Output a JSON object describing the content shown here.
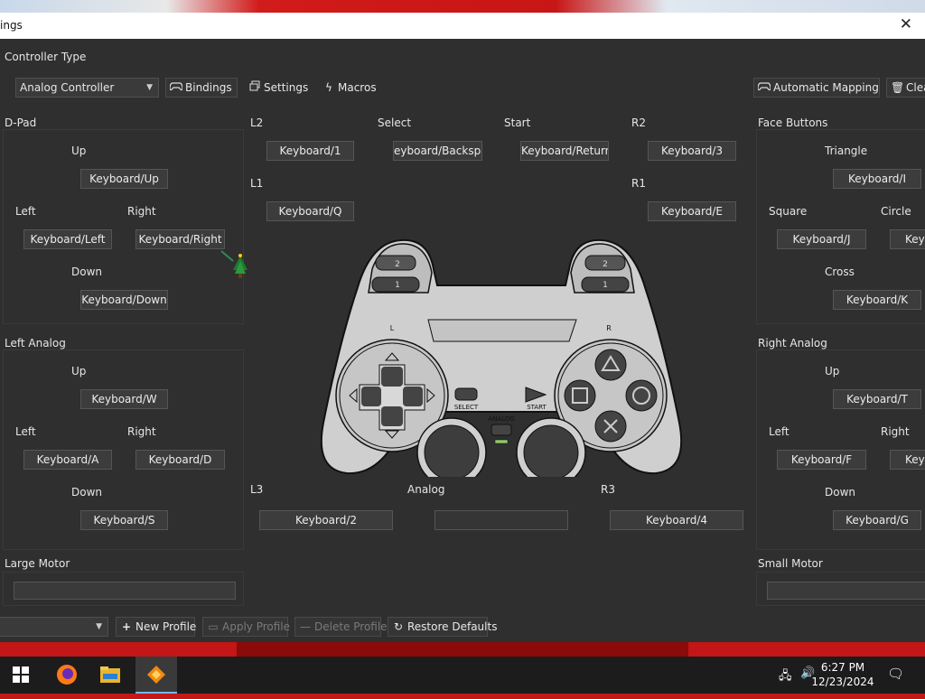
{
  "window": {
    "title": "ings"
  },
  "controller_type": {
    "label": "Controller Type",
    "value": "Analog Controller"
  },
  "toolbar": {
    "bindings": "Bindings",
    "settings": "Settings",
    "macros": "Macros",
    "auto_mapping": "Automatic Mapping",
    "clear": "Clea"
  },
  "dpad": {
    "title": "D-Pad",
    "up_label": "Up",
    "up": "Keyboard/Up",
    "left_label": "Left",
    "left": "Keyboard/Left",
    "right_label": "Right",
    "right": "Keyboard/Right",
    "down_label": "Down",
    "down": "Keyboard/Down"
  },
  "left_analog": {
    "title": "Left Analog",
    "up_label": "Up",
    "up": "Keyboard/W",
    "left_label": "Left",
    "left": "Keyboard/A",
    "right_label": "Right",
    "right": "Keyboard/D",
    "down_label": "Down",
    "down": "Keyboard/S"
  },
  "shoulders": {
    "l2_label": "L2",
    "l2": "Keyboard/1",
    "select_label": "Select",
    "select": "eyboard/Backspac",
    "start_label": "Start",
    "start": "Keyboard/Return",
    "r2_label": "R2",
    "r2": "Keyboard/3",
    "l1_label": "L1",
    "l1": "Keyboard/Q",
    "r1_label": "R1",
    "r1": "Keyboard/E"
  },
  "sticks": {
    "l3_label": "L3",
    "l3": "Keyboard/2",
    "analog_label": "Analog",
    "analog": "",
    "r3_label": "R3",
    "r3": "Keyboard/4"
  },
  "face": {
    "title": "Face Buttons",
    "triangle_label": "Triangle",
    "triangle": "Keyboard/I",
    "square_label": "Square",
    "square": "Keyboard/J",
    "circle_label": "Circle",
    "circle": "Keyb",
    "cross_label": "Cross",
    "cross": "Keyboard/K"
  },
  "right_analog": {
    "title": "Right Analog",
    "up_label": "Up",
    "up": "Keyboard/T",
    "left_label": "Left",
    "left": "Keyboard/F",
    "right_label": "Right",
    "right": "Keyb",
    "down_label": "Down",
    "down": "Keyboard/G"
  },
  "motors": {
    "large": "Large Motor",
    "small": "Small Motor"
  },
  "controller_image": {
    "l": "L",
    "r": "R",
    "select": "SELECT",
    "start": "START",
    "analog": "ANALOG",
    "l_num_top": "2",
    "l_num_bot": "1",
    "r_num_top": "2",
    "r_num_bot": "1"
  },
  "bottom": {
    "new_profile": "New Profile",
    "apply_profile": "Apply Profile",
    "delete_profile": "Delete Profile",
    "restore_defaults": "Restore Defaults"
  },
  "taskbar": {
    "time": "6:27 PM",
    "date": "12/23/2024"
  },
  "colors": {
    "window_bg": "#2f2f2f",
    "button_bg": "#3c3c3c",
    "taskbar_bg": "#1c1c1c",
    "desktop_red": "#c41818"
  }
}
